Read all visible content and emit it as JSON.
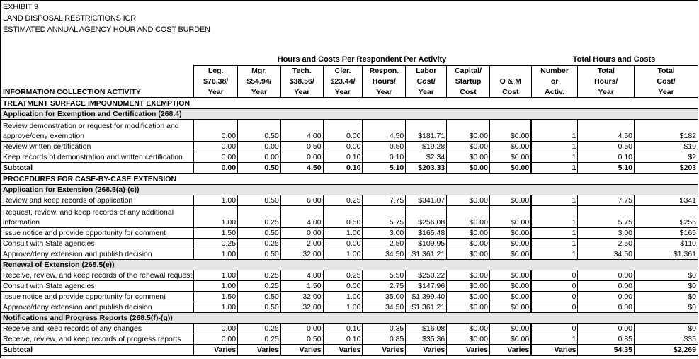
{
  "titles": [
    "EXHIBIT 9",
    "LAND DISPOSAL RESTRICTIONS ICR",
    "ESTIMATED ANNUAL AGENCY HOUR AND COST BURDEN"
  ],
  "group_headers": {
    "per_respondent": "Hours and Costs Per Respondent Per Activity",
    "totals": "Total Hours and Costs"
  },
  "columns": [
    {
      "l1": "Leg.",
      "l2": "$76.38/",
      "l3": "Year"
    },
    {
      "l1": "Mgr.",
      "l2": "$54.94/",
      "l3": "Year"
    },
    {
      "l1": "Tech.",
      "l2": "$38.56/",
      "l3": "Year"
    },
    {
      "l1": "Cler.",
      "l2": "$23.44/",
      "l3": "Year"
    },
    {
      "l1": "Respon.",
      "l2": "Hours/",
      "l3": "Year"
    },
    {
      "l1": "Labor",
      "l2": "Cost/",
      "l3": "Year"
    },
    {
      "l1": "Capital/",
      "l2": "Startup",
      "l3": "Cost"
    },
    {
      "l1": "",
      "l2": "O & M",
      "l3": "Cost"
    },
    {
      "l1": "Number",
      "l2": "or",
      "l3": "Activ."
    },
    {
      "l1": "Total",
      "l2": "Hours/",
      "l3": "Year"
    },
    {
      "l1": "Total",
      "l2": "Cost/",
      "l3": "Year"
    }
  ],
  "activity_header": "INFORMATION COLLECTION ACTIVITY",
  "rows": [
    {
      "type": "plain",
      "label": "TREATMENT SURFACE IMPOUNDMENT EXEMPTION"
    },
    {
      "type": "section",
      "label": "Application for Exemption and Certification (268.4)"
    },
    {
      "type": "tall",
      "label": "Review demonstration or request for modification and approve/deny exemption",
      "values": [
        "0.00",
        "0.50",
        "4.00",
        "0.00",
        "4.50",
        "$181.71",
        "$0.00",
        "$0.00",
        "1",
        "4.50",
        "$182"
      ]
    },
    {
      "type": "data",
      "label": "Review written certification",
      "values": [
        "0.00",
        "0.00",
        "0.50",
        "0.00",
        "0.50",
        "$19.28",
        "$0.00",
        "$0.00",
        "1",
        "0.50",
        "$19"
      ]
    },
    {
      "type": "data",
      "label": "Keep records of demonstration and written certification",
      "values": [
        "0.00",
        "0.00",
        "0.00",
        "0.10",
        "0.10",
        "$2.34",
        "$0.00",
        "$0.00",
        "1",
        "0.10",
        "$2"
      ]
    },
    {
      "type": "subtotal",
      "label": "Subtotal",
      "values": [
        "0.00",
        "0.50",
        "4.50",
        "0.10",
        "5.10",
        "$203.33",
        "$0.00",
        "$0.00",
        "1",
        "5.10",
        "$203"
      ]
    },
    {
      "type": "plain",
      "label": "PROCEDURES FOR CASE-BY-CASE EXTENSION"
    },
    {
      "type": "section",
      "label": "Application for Extension (268.5(a)-(c))"
    },
    {
      "type": "data",
      "label": "Review and keep records of application",
      "values": [
        "1.00",
        "0.50",
        "6.00",
        "0.25",
        "7.75",
        "$341.07",
        "$0.00",
        "$0.00",
        "1",
        "7.75",
        "$341"
      ]
    },
    {
      "type": "tall",
      "label": "Request, review, and keep records of any additional information",
      "values": [
        "1.00",
        "0.25",
        "4.00",
        "0.50",
        "5.75",
        "$256.08",
        "$0.00",
        "$0.00",
        "1",
        "5.75",
        "$256"
      ]
    },
    {
      "type": "data",
      "label": "Issue notice and provide opportunity for comment",
      "values": [
        "1.50",
        "0.50",
        "0.00",
        "1.00",
        "3.00",
        "$165.48",
        "$0.00",
        "$0.00",
        "1",
        "3.00",
        "$165"
      ]
    },
    {
      "type": "data",
      "label": "Consult with State agencies",
      "values": [
        "0.25",
        "0.25",
        "2.00",
        "0.00",
        "2.50",
        "$109.95",
        "$0.00",
        "$0.00",
        "1",
        "2.50",
        "$110"
      ]
    },
    {
      "type": "data",
      "label": "Approve/deny extension and publish decision",
      "values": [
        "1.00",
        "0.50",
        "32.00",
        "1.00",
        "34.50",
        "$1,361.21",
        "$0.00",
        "$0.00",
        "1",
        "34.50",
        "$1,361"
      ]
    },
    {
      "type": "section",
      "label": "Renewal of Extension (268.5(e))"
    },
    {
      "type": "data",
      "label": "Receive, review, and keep records of the renewal request",
      "values": [
        "1.00",
        "0.25",
        "4.00",
        "0.25",
        "5.50",
        "$250.22",
        "$0.00",
        "$0.00",
        "0",
        "0.00",
        "$0"
      ]
    },
    {
      "type": "data",
      "label": "Consult with State agencies",
      "values": [
        "1.00",
        "0.25",
        "1.50",
        "0.00",
        "2.75",
        "$147.96",
        "$0.00",
        "$0.00",
        "0",
        "0.00",
        "$0"
      ]
    },
    {
      "type": "data",
      "label": "Issue notice and provide opportunity for comment",
      "values": [
        "1.50",
        "0.50",
        "32.00",
        "1.00",
        "35.00",
        "$1,399.40",
        "$0.00",
        "$0.00",
        "0",
        "0.00",
        "$0"
      ]
    },
    {
      "type": "data",
      "label": "Approve/deny extension and publish decision",
      "values": [
        "1.00",
        "0.50",
        "32.00",
        "1.00",
        "34.50",
        "$1,361.21",
        "$0.00",
        "$0.00",
        "0",
        "0.00",
        "$0"
      ]
    },
    {
      "type": "section",
      "label": "Notifications and Progress Reports (268.5(f)-(g))"
    },
    {
      "type": "data",
      "label": "Receive and keep records of any changes",
      "values": [
        "0.00",
        "0.25",
        "0.00",
        "0.10",
        "0.35",
        "$16.08",
        "$0.00",
        "$0.00",
        "0",
        "0.00",
        "$0"
      ]
    },
    {
      "type": "data",
      "label": "Receive, review, and keep records of progress reports",
      "values": [
        "0.00",
        "0.25",
        "0.50",
        "0.10",
        "0.85",
        "$35.36",
        "$0.00",
        "$0.00",
        "1",
        "0.85",
        "$35"
      ]
    },
    {
      "type": "subtotal",
      "label": "Subtotal",
      "values": [
        "Varies",
        "Varies",
        "Varies",
        "Varies",
        "Varies",
        "Varies",
        "Varies",
        "Varies",
        "Varies",
        "54.35",
        "$2,269"
      ]
    }
  ]
}
